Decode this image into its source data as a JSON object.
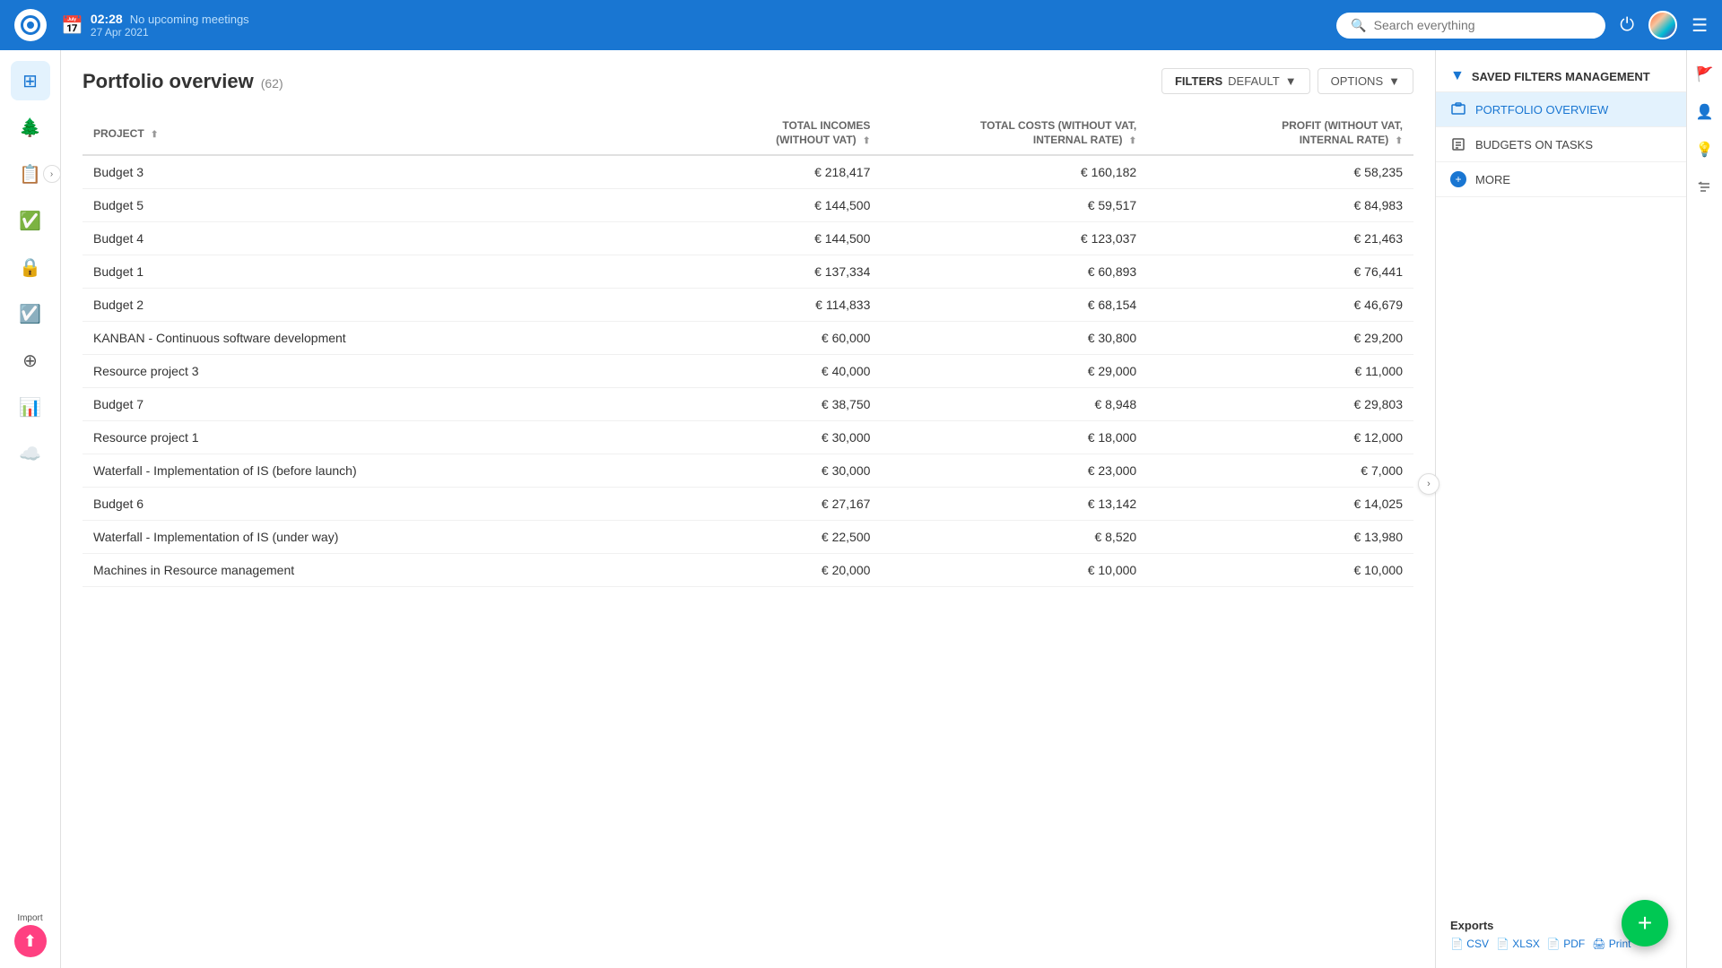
{
  "topbar": {
    "time": "02:28",
    "meeting": "No upcoming meetings",
    "date": "27 Apr 2021",
    "search_placeholder": "Search everything"
  },
  "page": {
    "title": "Portfolio overview",
    "count": "(62)",
    "filters_label": "FILTERS",
    "filters_value": "DEFAULT",
    "options_label": "OPTIONS"
  },
  "table": {
    "columns": [
      {
        "key": "project",
        "label": "PROJECT"
      },
      {
        "key": "income",
        "label": "TOTAL INCOMES (WITHOUT VAT)"
      },
      {
        "key": "costs",
        "label": "TOTAL COSTS (WITHOUT VAT, INTERNAL RATE)"
      },
      {
        "key": "profit",
        "label": "PROFIT (WITHOUT VAT, INTERNAL RATE)"
      }
    ],
    "rows": [
      {
        "project": "Budget 3",
        "income": "€ 218,417",
        "costs": "€ 160,182",
        "profit": "€ 58,235"
      },
      {
        "project": "Budget 5",
        "income": "€ 144,500",
        "costs": "€ 59,517",
        "profit": "€ 84,983"
      },
      {
        "project": "Budget 4",
        "income": "€ 144,500",
        "costs": "€ 123,037",
        "profit": "€ 21,463"
      },
      {
        "project": "Budget 1",
        "income": "€ 137,334",
        "costs": "€ 60,893",
        "profit": "€ 76,441"
      },
      {
        "project": "Budget 2",
        "income": "€ 114,833",
        "costs": "€ 68,154",
        "profit": "€ 46,679"
      },
      {
        "project": "KANBAN - Continuous software development",
        "income": "€ 60,000",
        "costs": "€ 30,800",
        "profit": "€ 29,200"
      },
      {
        "project": "Resource project 3",
        "income": "€ 40,000",
        "costs": "€ 29,000",
        "profit": "€ 11,000"
      },
      {
        "project": "Budget 7",
        "income": "€ 38,750",
        "costs": "€ 8,948",
        "profit": "€ 29,803"
      },
      {
        "project": "Resource project 1",
        "income": "€ 30,000",
        "costs": "€ 18,000",
        "profit": "€ 12,000"
      },
      {
        "project": "Waterfall - Implementation of IS (before launch)",
        "income": "€ 30,000",
        "costs": "€ 23,000",
        "profit": "€ 7,000"
      },
      {
        "project": "Budget 6",
        "income": "€ 27,167",
        "costs": "€ 13,142",
        "profit": "€ 14,025"
      },
      {
        "project": "Waterfall - Implementation of IS (under way)",
        "income": "€ 22,500",
        "costs": "€ 8,520",
        "profit": "€ 13,980"
      },
      {
        "project": "Machines in Resource management",
        "income": "€ 20,000",
        "costs": "€ 10,000",
        "profit": "€ 10,000"
      }
    ]
  },
  "filter_panel": {
    "title": "SAVED FILTERS MANAGEMENT",
    "items": [
      {
        "label": "PORTFOLIO OVERVIEW",
        "icon": "portfolio"
      },
      {
        "label": "BUDGETS ON TASKS",
        "icon": "budget"
      }
    ],
    "more_label": "MORE"
  },
  "exports": {
    "title": "Exports",
    "links": [
      "CSV",
      "XLSX",
      "PDF",
      "Print"
    ]
  },
  "import_label": "Import",
  "fab_label": "+"
}
